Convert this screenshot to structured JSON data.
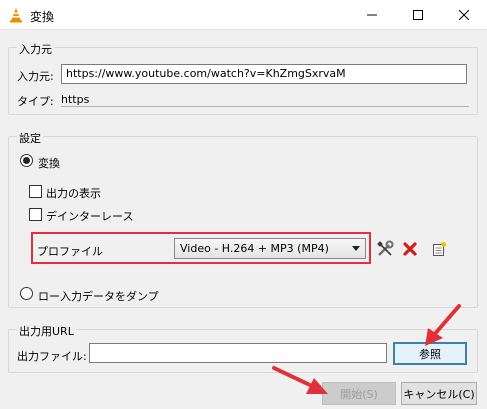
{
  "window": {
    "title": "変換"
  },
  "source": {
    "legend": "入力元",
    "url_label": "入力元:",
    "url_value": "https://www.youtube.com/watch?v=KhZmgSxrvaM",
    "type_label": "タイプ:",
    "type_value": "https"
  },
  "settings": {
    "legend": "設定",
    "convert_label": "変換",
    "show_output_label": "出力の表示",
    "deinterlace_label": "デインターレース",
    "profile_label": "プロファイル",
    "profile_value": "Video - H.264 + MP3 (MP4)",
    "dump_label": "ロー入力データをダンプ"
  },
  "output": {
    "legend": "出力用URL",
    "file_label": "出力ファイル:",
    "file_value": "",
    "browse_label": "参照"
  },
  "footer": {
    "start_label": "開始(S)",
    "cancel_label": "キャンセル(C)"
  },
  "colors": {
    "highlight": "#e0303a",
    "annotation_arrow": "#e0303a"
  },
  "icons": {
    "app": "vlc-cone-icon",
    "edit_profile": "wrench-screwdriver-icon",
    "delete_profile": "red-x-icon",
    "new_profile": "new-document-icon"
  }
}
